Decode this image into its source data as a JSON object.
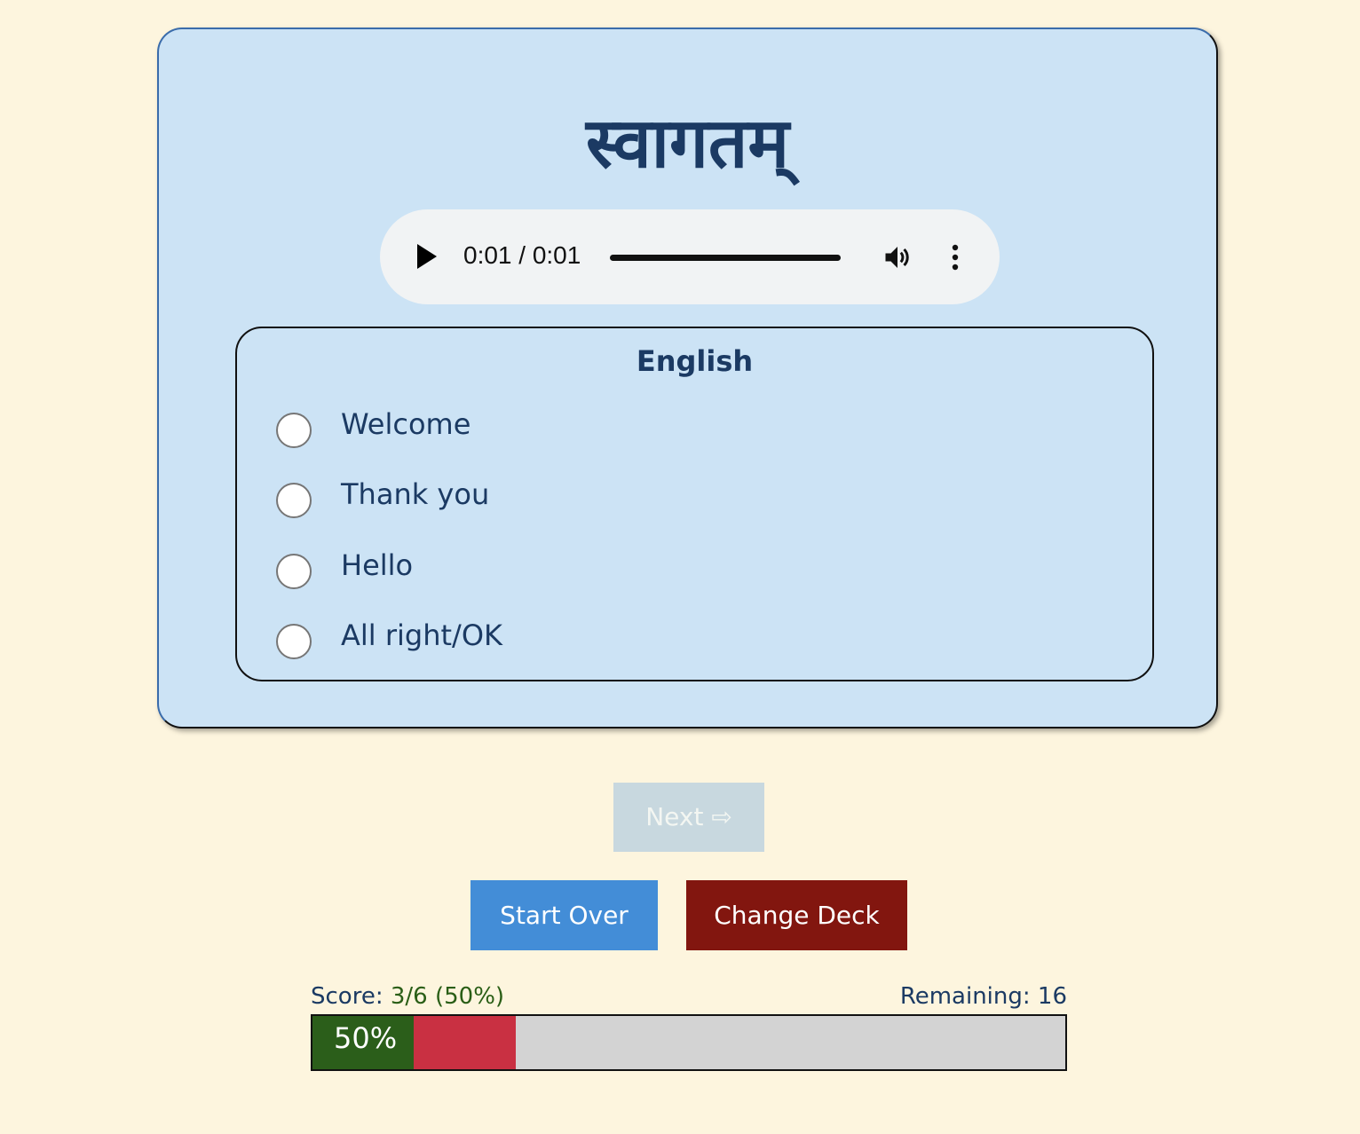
{
  "card": {
    "word": "स्वागतम्"
  },
  "audio": {
    "time": "0:01 / 0:01",
    "progress": 1.0
  },
  "question": {
    "legend": "English",
    "options": [
      {
        "label": "Welcome"
      },
      {
        "label": "Thank you"
      },
      {
        "label": "Hello"
      },
      {
        "label": "All right/OK"
      }
    ]
  },
  "buttons": {
    "next": "Next ⇨",
    "start_over": "Start Over",
    "change_deck": "Change Deck"
  },
  "score": {
    "label": "Score:",
    "value": "3/6 (50%)",
    "remaining": "Remaining: 16",
    "percent_label": "50%",
    "correct_fraction": 0.135,
    "wrong_fraction": 0.135
  },
  "colors": {
    "background": "#fdf5de",
    "card": "#cce3f5",
    "text": "#1b3a63",
    "correct": "#2b5e1a",
    "wrong": "#c93042",
    "start_over": "#438dd7",
    "change_deck": "#82160f"
  }
}
